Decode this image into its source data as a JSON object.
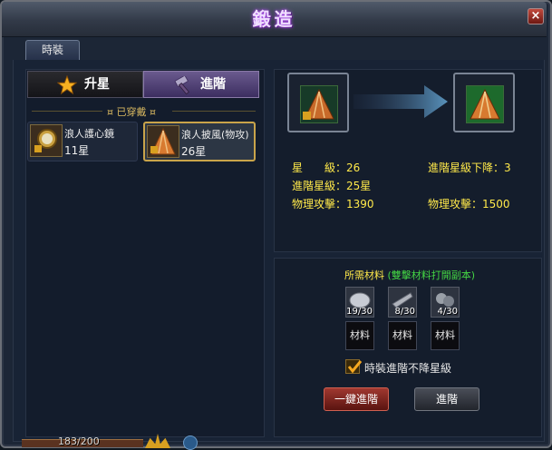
{
  "window": {
    "title": "鍛造",
    "close_glyph": "×"
  },
  "tabs": [
    {
      "label": "時裝",
      "active": true
    }
  ],
  "subtabs": {
    "star_label": "升星",
    "advance_label": "進階",
    "active": "advance"
  },
  "equipped_header": "已穿戴",
  "items": [
    {
      "name": "浪人護心鏡",
      "level": "11星",
      "icon": "mirror-amulet-icon",
      "selected": false
    },
    {
      "name": "浪人披風(物攻)",
      "level": "26星",
      "icon": "cloak-icon",
      "selected": true
    }
  ],
  "stats": {
    "star_label": "星　　級：",
    "star_value": "26",
    "adv_star_label": "進階星級：",
    "adv_star_value": "25星",
    "phys_label": "物理攻擊：",
    "phys_current": "1390",
    "drop_label": "進階星級下降：",
    "drop_value": "3",
    "phys_next_label": "物理攻擊：",
    "phys_next": "1500"
  },
  "materials": {
    "title": "所需材料",
    "note": "(雙擊材料打開副本)",
    "items": [
      {
        "icon": "material-stone-icon",
        "count": "19/30"
      },
      {
        "icon": "material-blade-icon",
        "count": "8/30"
      },
      {
        "icon": "material-ore-icon",
        "count": "4/30"
      }
    ],
    "slot_labels": [
      "材料",
      "材料",
      "材料"
    ]
  },
  "option": {
    "label": "時裝進階不降星級",
    "checked": true
  },
  "buttons": {
    "one_click": "一鍵進階",
    "advance": "進階"
  },
  "footer": {
    "xp_text": "183/200"
  },
  "colors": {
    "stat_yellow": "#ffe94a",
    "note_green": "#44d644",
    "title_glow": "#c060ff",
    "selected_border": "#c9a44a"
  }
}
